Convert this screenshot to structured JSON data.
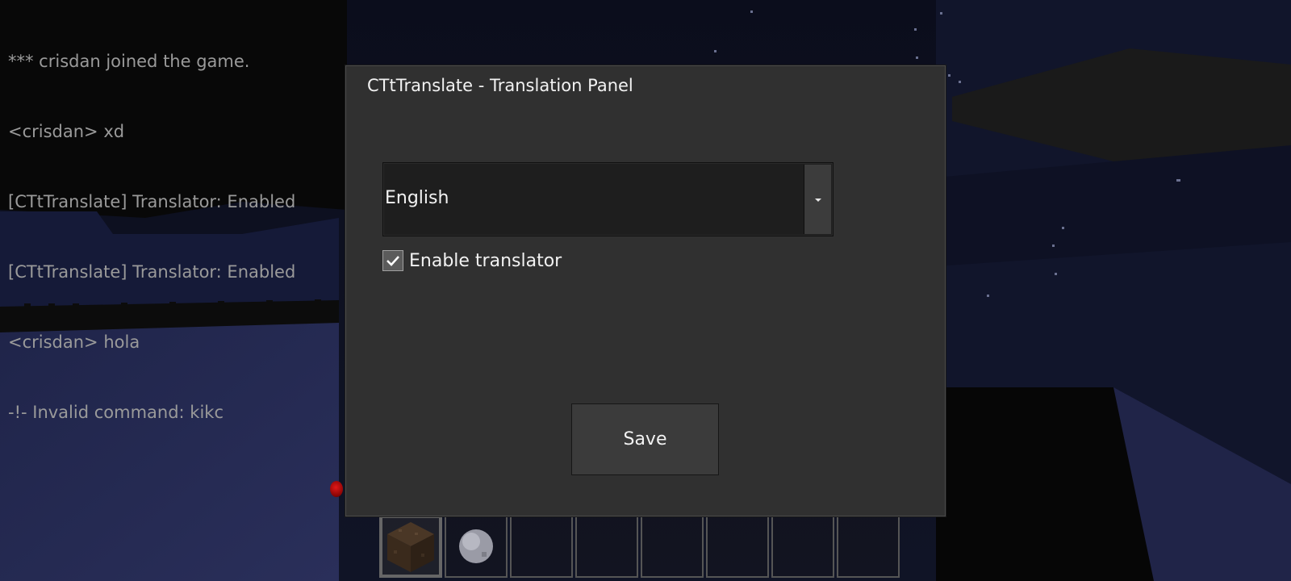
{
  "chat": {
    "lines": [
      "*** crisdan joined the game.",
      "<crisdan> xd",
      "[CTtTranslate] Translator: Enabled",
      "[CTtTranslate] Translator: Enabled",
      "<crisdan> hola",
      "-!- Invalid command: kikc"
    ]
  },
  "panel": {
    "title": "CTtTranslate - Translation Panel",
    "language_select": {
      "value": "English"
    },
    "enable_translator": {
      "label": "Enable translator",
      "checked": true
    },
    "save_label": "Save"
  },
  "hotbar": {
    "selected_index": 0,
    "slots": [
      {
        "item": "dirt-block-icon"
      },
      {
        "item": "snowball-icon"
      },
      {
        "item": null
      },
      {
        "item": null
      },
      {
        "item": null
      },
      {
        "item": null
      },
      {
        "item": null
      },
      {
        "item": null
      }
    ]
  },
  "colors": {
    "panel_bg": "#303030",
    "chat_text": "#9a9a9a",
    "text": "#f2f2f2"
  }
}
